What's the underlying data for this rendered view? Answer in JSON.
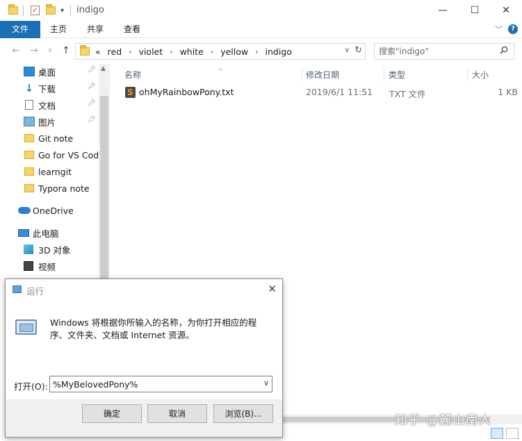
{
  "window": {
    "title": "indigo"
  },
  "ribbon": {
    "tabs": [
      {
        "label": "文件",
        "active": true
      },
      {
        "label": "主页",
        "active": false
      },
      {
        "label": "共享",
        "active": false
      },
      {
        "label": "查看",
        "active": false
      }
    ]
  },
  "address": {
    "overflow": "«",
    "crumbs": [
      "red",
      "violet",
      "white",
      "yellow",
      "indigo"
    ]
  },
  "search": {
    "placeholder": "搜索\"indigo\""
  },
  "nav": {
    "quick_access": [
      {
        "label": "桌面",
        "icon": "desktop-icon",
        "pinned": true
      },
      {
        "label": "下载",
        "icon": "download-icon",
        "pinned": true
      },
      {
        "label": "文档",
        "icon": "document-icon",
        "pinned": true
      },
      {
        "label": "图片",
        "icon": "pictures-icon",
        "pinned": true
      },
      {
        "label": "Git note",
        "icon": "folder-icon",
        "pinned": false
      },
      {
        "label": "Go for VS Cod",
        "icon": "folder-icon",
        "pinned": false
      },
      {
        "label": "learngit",
        "icon": "folder-icon",
        "pinned": false
      },
      {
        "label": "Typora note",
        "icon": "folder-icon",
        "pinned": false
      }
    ],
    "onedrive": "OneDrive",
    "this_pc": "此电脑",
    "pc_items": [
      {
        "label": "3D 对象",
        "icon": "3d-objects-icon"
      },
      {
        "label": "视频",
        "icon": "video-icon"
      }
    ]
  },
  "columns": {
    "name": "名称",
    "modified": "修改日期",
    "type": "类型",
    "size": "大小"
  },
  "files": [
    {
      "name": "ohMyRainbowPony.txt",
      "modified": "2019/6/1 11:51",
      "type": "TXT 文件",
      "size": "1 KB"
    }
  ],
  "watermark": "知乎 @麓山南人",
  "run_dialog": {
    "title": "运行",
    "description": "Windows 将根据你所输入的名称，为你打开相应的程序、文件夹、文档或 Internet 资源。",
    "open_label": "打开(O):",
    "open_value": "%MyBelovedPony%",
    "ok_label": "确定",
    "cancel_label": "取消",
    "browse_label": "浏览(B)..."
  }
}
